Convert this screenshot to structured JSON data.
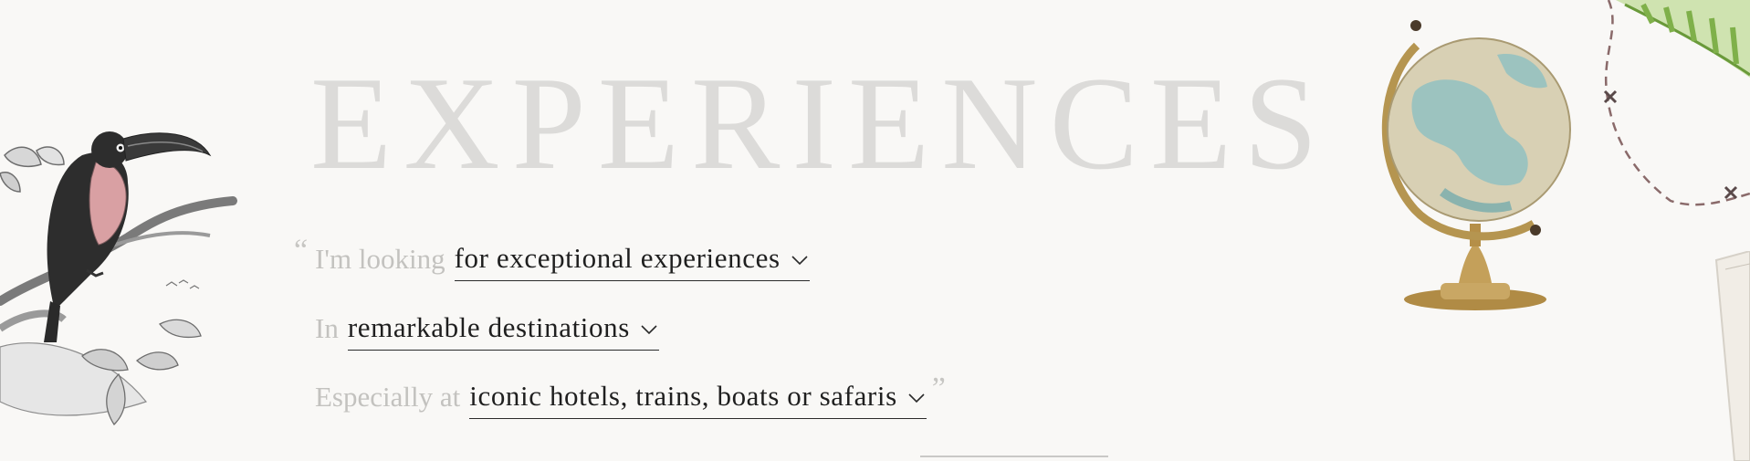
{
  "hero": {
    "title": "EXPERIENCES"
  },
  "sentence": {
    "quote_open": "“",
    "quote_close": "”",
    "line1": {
      "lead": "I'm looking",
      "value": "for exceptional experiences"
    },
    "line2": {
      "lead": "In",
      "value": "remarkable destinations"
    },
    "line3": {
      "lead": "Especially at",
      "value": "iconic hotels, trains, boats or safaris"
    }
  },
  "icons": {
    "dropdown": "chevron-down-icon",
    "illustration_left": "toucan-illustration",
    "illustration_right": "globe-illustration"
  },
  "colors": {
    "background": "#f9f8f6",
    "title": "#dcdbd9",
    "lead_text": "#c3c2bf",
    "value_text": "#1f1f1f",
    "underline": "#2a2a2a",
    "toucan_chest": "#d9a0a3",
    "globe_ocean": "#9cc3bf",
    "globe_brass": "#b59550",
    "travel_path": "#8a6a6a"
  }
}
